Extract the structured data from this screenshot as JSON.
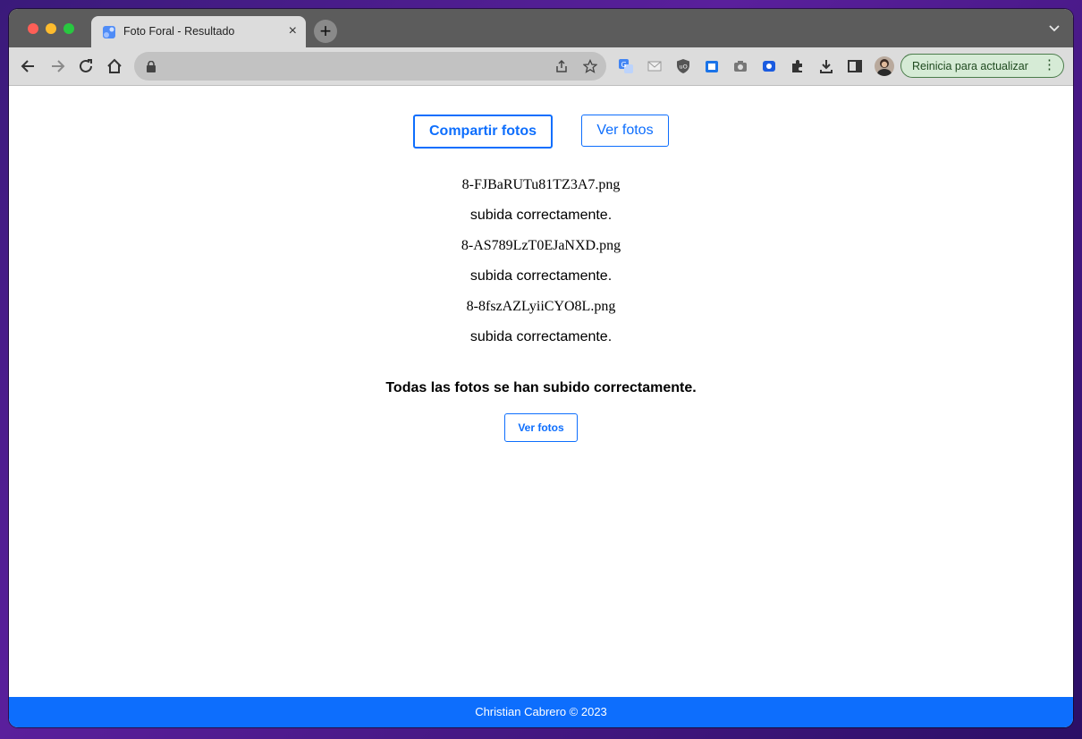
{
  "browser": {
    "tab": {
      "title": "Foto Foral - Resultado",
      "close": "×"
    },
    "new_tab": "+",
    "update_button": {
      "label": "Reinicia para actualizar",
      "menu": "⋮"
    },
    "icons": [
      "back-icon",
      "forward-icon",
      "reload-icon",
      "home-icon",
      "lock-icon",
      "share-icon",
      "star-icon",
      "translate-icon",
      "mail-icon",
      "shield-icon",
      "calendar-icon",
      "camera-icon",
      "record-icon",
      "puzzle-icon",
      "download-icon",
      "sidepanel-icon"
    ]
  },
  "page": {
    "nav": {
      "share_label": "Compartir fotos",
      "view_label": "Ver fotos"
    },
    "results": [
      {
        "file": "8-FJBaRUTu81TZ3A7.png",
        "status": "subida correctamente."
      },
      {
        "file": "8-AS789LzT0EJaNXD.png",
        "status": "subida correctamente."
      },
      {
        "file": "8-8fszAZLyiiCYO8L.png",
        "status": "subida correctamente."
      }
    ],
    "summary": "Todas las fotos se han subido correctamente.",
    "view_button": "Ver fotos"
  },
  "footer": {
    "text": "Christian Cabrero © 2023"
  },
  "colors": {
    "accent": "#0d6efd",
    "footer_bg": "#0d6efd",
    "tabstrip": "#5c5c5c"
  }
}
